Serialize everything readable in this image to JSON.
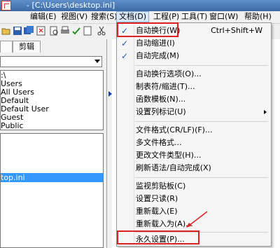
{
  "window": {
    "title": "- [C:\\Users\\desktop.ini]"
  },
  "menubar": {
    "items": [
      {
        "label": "编辑(E)"
      },
      {
        "label": "视图(V)"
      },
      {
        "label": "搜索(S)"
      },
      {
        "label": "文档(D)"
      },
      {
        "label": "工程(P)"
      },
      {
        "label": "工具(T)"
      },
      {
        "label": "窗口(W)"
      },
      {
        "label": "帮助(H)"
      }
    ]
  },
  "left_panel": {
    "tab_label": "剪辑",
    "folders": [
      ":\\",
      "Users",
      "All Users",
      "Default",
      "Default User",
      "Guest",
      "Public"
    ],
    "selected_file": "top.ini"
  },
  "doc_menu": {
    "items": [
      {
        "label": "自动换行(W)",
        "shortcut": "Ctrl+Shift+W",
        "checked": true
      },
      {
        "label": "自动缩进(I)",
        "checked": true
      },
      {
        "label": "自动完成(M)",
        "checked": true
      },
      {
        "label": "自动换行选项(O)..."
      },
      {
        "label": "制表符/缩进(T)..."
      },
      {
        "label": "函数模板(N)..."
      },
      {
        "label": "设置列标记(U)",
        "submenu": true
      },
      {
        "label": "文件格式(CR/LF)(F)..."
      },
      {
        "label": "多文件格式..."
      },
      {
        "label": "更改文件类型(H)..."
      },
      {
        "label": "刷新语法/自动完成(X)"
      },
      {
        "label": "监视剪贴板(C)"
      },
      {
        "label": "设置只读(R)"
      },
      {
        "label": "重新载入(E)"
      },
      {
        "label": "重新载入为(A)..."
      },
      {
        "label": "永久设置(P)..."
      }
    ],
    "check_mark": "✓"
  },
  "colors": {
    "highlight_box": "#e02020",
    "selection": "#3399ff",
    "check": "#2255cc"
  }
}
